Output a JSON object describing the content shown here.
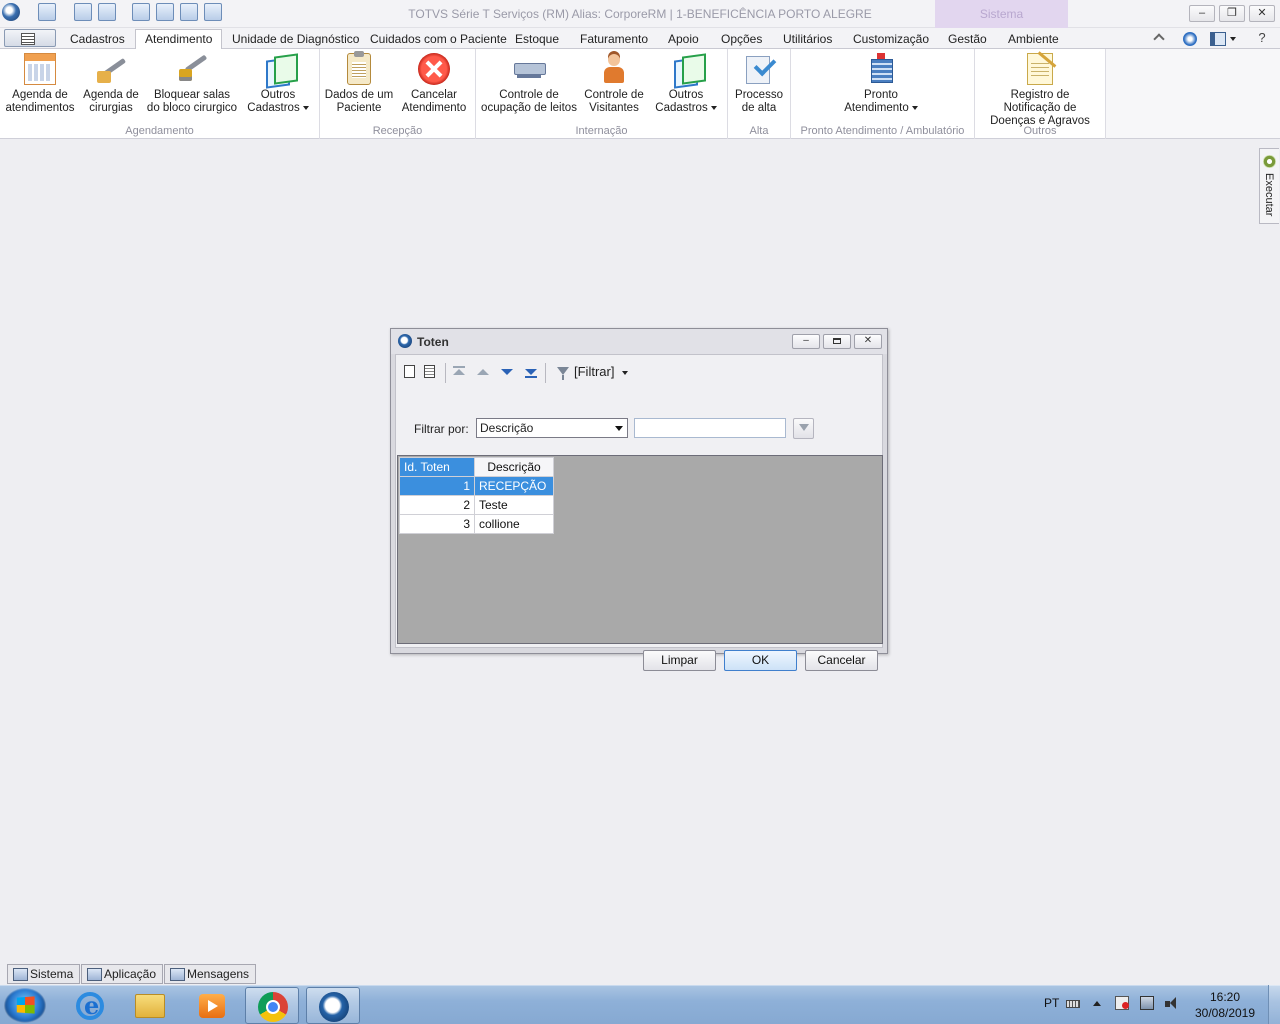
{
  "window": {
    "title": "TOTVS Série T Serviços (RM) Alias: CorporeRM | 1-BENEFICÊNCIA PORTO ALEGRE",
    "context_tab": "Sistema",
    "controls": {
      "minimize": "‒",
      "restore": "❐",
      "close": "✕"
    }
  },
  "menu": {
    "tabs": [
      "Cadastros",
      "Atendimento",
      "Unidade de Diagnóstico",
      "Cuidados com o Paciente",
      "Estoque",
      "Faturamento",
      "Apoio",
      "Opções",
      "Utilitários",
      "Customização",
      "Gestão",
      "Ambiente"
    ],
    "active_tab": "Atendimento"
  },
  "ribbon": {
    "groups": [
      {
        "label": "Agendamento",
        "buttons": [
          {
            "label": "Agenda de atendimentos",
            "icon": "calendar-icon"
          },
          {
            "label": "Agenda de cirurgias",
            "icon": "surgery-tools-icon"
          },
          {
            "label": "Bloquear salas do bloco cirurgico",
            "icon": "lock-tools-icon"
          },
          {
            "label": "Outros Cadastros",
            "icon": "pages-icon",
            "dropdown": true
          }
        ]
      },
      {
        "label": "Recepção",
        "buttons": [
          {
            "label": "Dados de um Paciente",
            "icon": "clipboard-icon"
          },
          {
            "label": "Cancelar Atendimento",
            "icon": "cancel-icon"
          }
        ]
      },
      {
        "label": "Internação",
        "buttons": [
          {
            "label": "Controle de ocupação de leitos",
            "icon": "bed-icon"
          },
          {
            "label": "Controle de Visitantes",
            "icon": "visitor-icon"
          },
          {
            "label": "Outros Cadastros",
            "icon": "pages-icon",
            "dropdown": true
          }
        ]
      },
      {
        "label": "Alta",
        "buttons": [
          {
            "label": "Processo de alta",
            "icon": "discharge-icon"
          }
        ]
      },
      {
        "label": "Pronto Atendimento / Ambulatório",
        "buttons": [
          {
            "label": "Pronto Atendimento",
            "icon": "hospital-icon",
            "dropdown": true
          }
        ]
      },
      {
        "label": "Outros",
        "buttons": [
          {
            "label": "Registro de Notificação de Doenças e Agravos",
            "icon": "notification-icon"
          }
        ]
      }
    ]
  },
  "side_panel": {
    "label": "Executar",
    "icon": "gear-icon"
  },
  "dialog": {
    "title": "Toten",
    "toolbar": {
      "filter_label": "[Filtrar]",
      "buttons": [
        "new-icon",
        "edit-icon",
        "first-record-icon",
        "previous-record-icon",
        "next-record-icon",
        "last-record-icon",
        "filter-icon"
      ]
    },
    "filter": {
      "label": "Filtrar por:",
      "field_value": "Descrição",
      "search_value": ""
    },
    "grid": {
      "columns": [
        "Id. Toten",
        "Descrição"
      ],
      "rows": [
        {
          "id": "1",
          "descricao": "RECEPÇÃO",
          "selected": true
        },
        {
          "id": "2",
          "descricao": "Teste",
          "selected": false
        },
        {
          "id": "3",
          "descricao": "collione",
          "selected": false
        }
      ]
    },
    "buttons": {
      "clear": "Limpar",
      "ok": "OK",
      "cancel": "Cancelar"
    }
  },
  "status_tabs": [
    "Sistema",
    "Aplicação",
    "Mensagens"
  ],
  "taskbar": {
    "language": "PT",
    "time": "16:20",
    "date": "30/08/2019",
    "apps": [
      "internet-explorer-icon",
      "file-explorer-icon",
      "media-player-icon",
      "chrome-icon",
      "totvs-icon"
    ]
  },
  "colors": {
    "selection": "#3b8fde",
    "ribbon_background": "#ffffff",
    "workspace": "#eeeef2",
    "grid_background": "#a9a9a9"
  }
}
